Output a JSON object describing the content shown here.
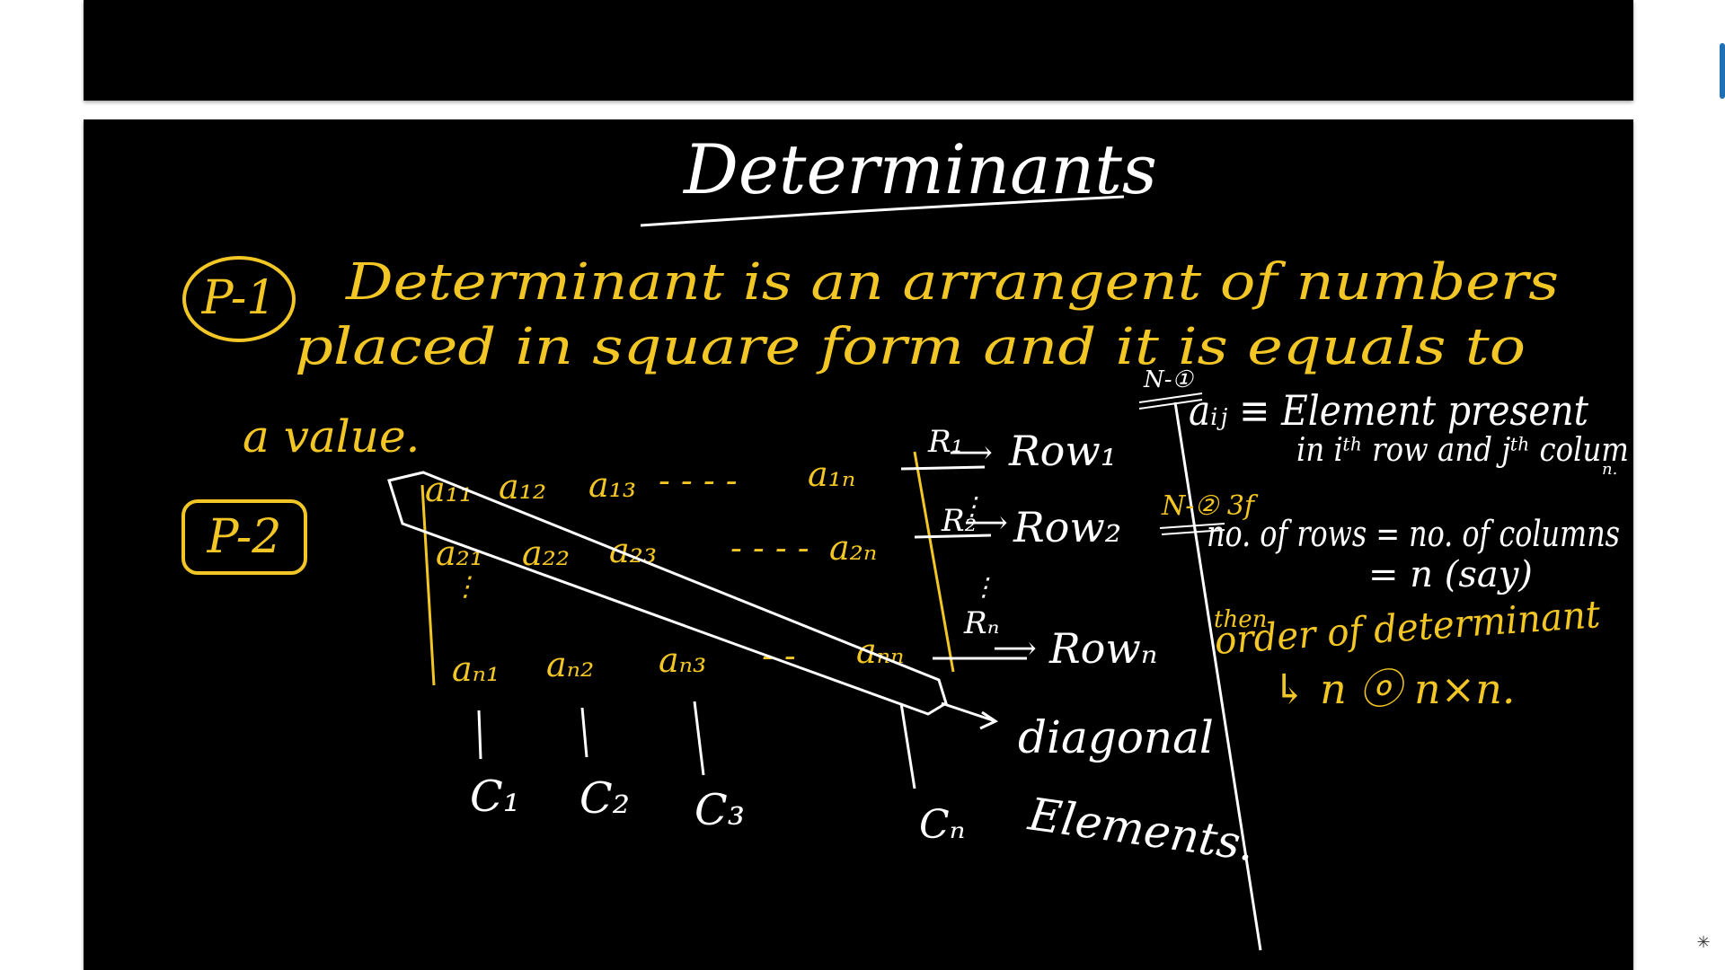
{
  "colors": {
    "ink_white": "#ffffff",
    "ink_yellow": "#f2c624",
    "page_background": "#000000",
    "viewer_background": "#ffffff",
    "scroll_accent": "#1f6fb5"
  },
  "icons": {
    "corner": "sparkle-icon"
  },
  "notes": {
    "title": "Determinants",
    "p1_badge": "P-1",
    "p1_line1": "Determinant is an arrangent of numbers",
    "p1_line2": "placed in square form and it is equals to",
    "p1_line3": "a value.",
    "p2_badge": "P-2",
    "matrix": {
      "row1": [
        "a₁₁",
        "a₁₂",
        "a₁₃",
        "- - - -",
        "a₁ₙ"
      ],
      "row2": [
        "a₂₁",
        "a₂₂",
        "a₂₃",
        "- - - -",
        "a₂ₙ"
      ],
      "rown": [
        "aₙ₁",
        "aₙ₂",
        "aₙ₃",
        "- -",
        "aₙₙ"
      ],
      "row_labels": [
        "R₁",
        "R₂",
        "Rₙ"
      ],
      "row_names": [
        "Row₁",
        "Row₂",
        "Rowₙ"
      ],
      "column_labels": [
        "C₁",
        "C₂",
        "C₃",
        "Cₙ"
      ],
      "diagonal_label_1": "diagonal",
      "diagonal_label_2": "Elements."
    },
    "note1_tag": "N-①",
    "note1_line1": "aᵢⱼ ≡ Element present",
    "note1_line2": "in iᵗʰ row and jᵗʰ colum",
    "note1_sub": "n.",
    "note2_tag": "N-② 3f",
    "note2_line1": "no. of rows = no. of columns",
    "note2_line2": "= n (say)",
    "note2_then": "then",
    "note2_line3": "order of determinant",
    "note2_line4": "↳ n ⓞ n×n."
  }
}
